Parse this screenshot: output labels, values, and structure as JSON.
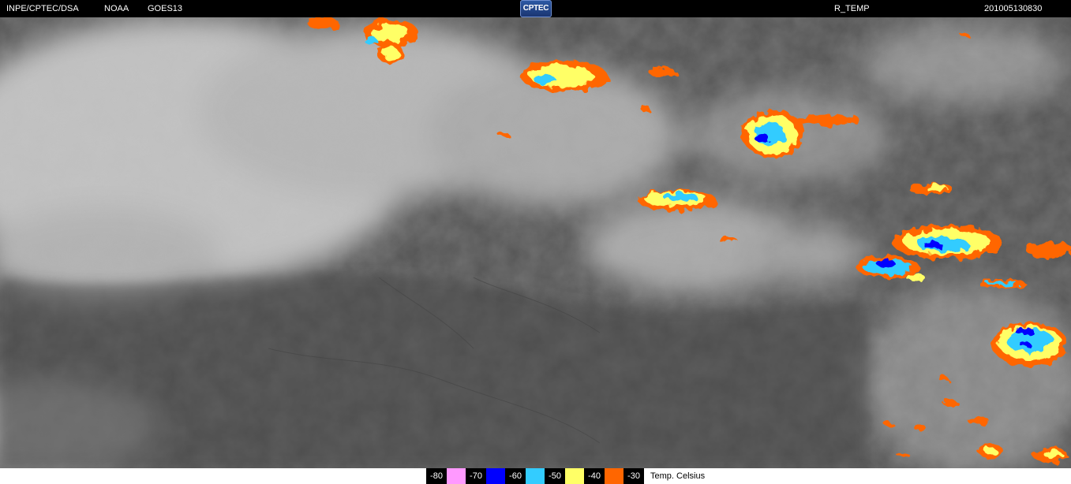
{
  "header": {
    "org": "INPE/CPTEC/DSA",
    "agency": "NOAA",
    "satellite": "GOES13",
    "logo": "CPTEC",
    "product": "R_TEMP",
    "timestamp": "201005130830"
  },
  "legend": {
    "items": [
      {
        "value": "-80",
        "color": "#ff99ff"
      },
      {
        "value": "-70",
        "color": "#0000ff"
      },
      {
        "value": "-60",
        "color": "#33ccff"
      },
      {
        "value": "-50",
        "color": "#ffff66"
      },
      {
        "value": "-40",
        "color": "#ff6600"
      },
      {
        "value": "-30",
        "color": "#000000"
      }
    ],
    "unit": "Temp. Celsius"
  },
  "colors": {
    "background_dark": "#505050",
    "cloud_light": "#bdbdbd",
    "header_bg": "#000000"
  }
}
